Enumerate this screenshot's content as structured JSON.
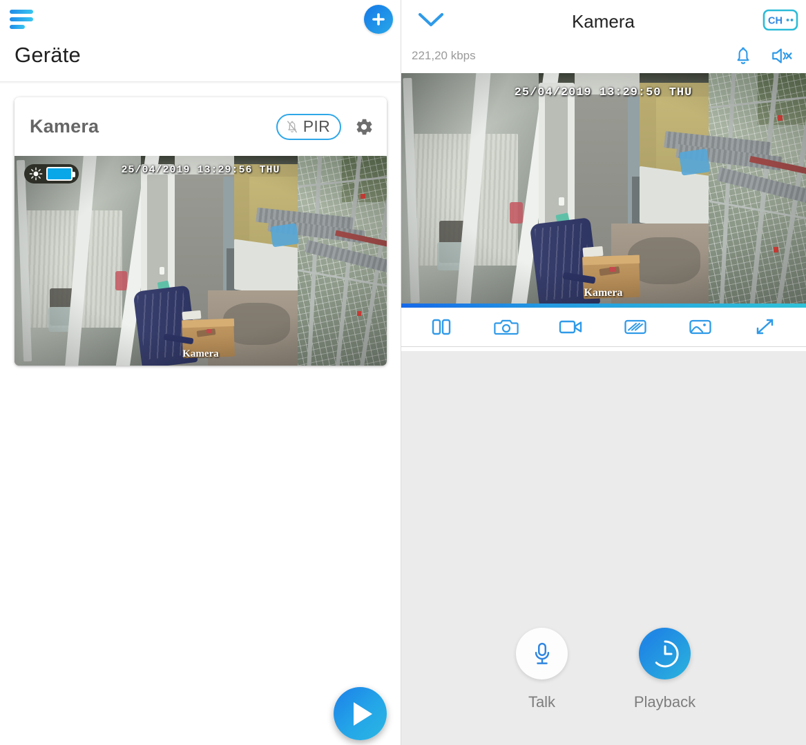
{
  "left": {
    "menu_icon": "hamburger-menu-icon",
    "add_icon": "add-plus-icon",
    "title": "Geräte",
    "card": {
      "name": "Kamera",
      "pir_label": "PIR",
      "pir_icon": "bell-slash-icon",
      "settings_icon": "gear-icon",
      "video": {
        "timestamp": "25/04/2019  13:29:56  THU",
        "watermark": "Kamera",
        "status_icons": [
          "sun-icon",
          "battery-icon"
        ]
      }
    },
    "play_fab": {
      "icon": "play-icon",
      "label": ""
    }
  },
  "right": {
    "collapse_icon": "chevron-down-icon",
    "title": "Kamera",
    "channel_button": {
      "label": "CH",
      "icon": "channel-icon"
    },
    "bitrate": "221,20 kbps",
    "alarm_icon": "bell-icon",
    "mute_icon": "speaker-mute-icon",
    "video": {
      "timestamp": "25/04/2019  13:29:50  THU",
      "watermark": "Kamera"
    },
    "toolbar": [
      {
        "name": "split-screen-button",
        "icon": "split-screen-icon"
      },
      {
        "name": "snapshot-button",
        "icon": "camera-icon"
      },
      {
        "name": "record-button",
        "icon": "video-camera-icon"
      },
      {
        "name": "stream-quality-button",
        "icon": "signal-lines-icon"
      },
      {
        "name": "gallery-button",
        "icon": "image-icon"
      },
      {
        "name": "fullscreen-button",
        "icon": "expand-arrows-icon"
      }
    ],
    "actions": [
      {
        "label": "Talk",
        "icon": "microphone-icon",
        "style": "white"
      },
      {
        "label": "Playback",
        "icon": "clock-icon",
        "style": "blue"
      }
    ]
  },
  "colors": {
    "accent_blue": "#1e8ae8",
    "accent_cyan": "#2bb6e2",
    "badge_border": "#2ea7e8",
    "text_dark": "#222222",
    "text_muted": "#9a9a9a",
    "panel_bg": "#ebebeb"
  }
}
